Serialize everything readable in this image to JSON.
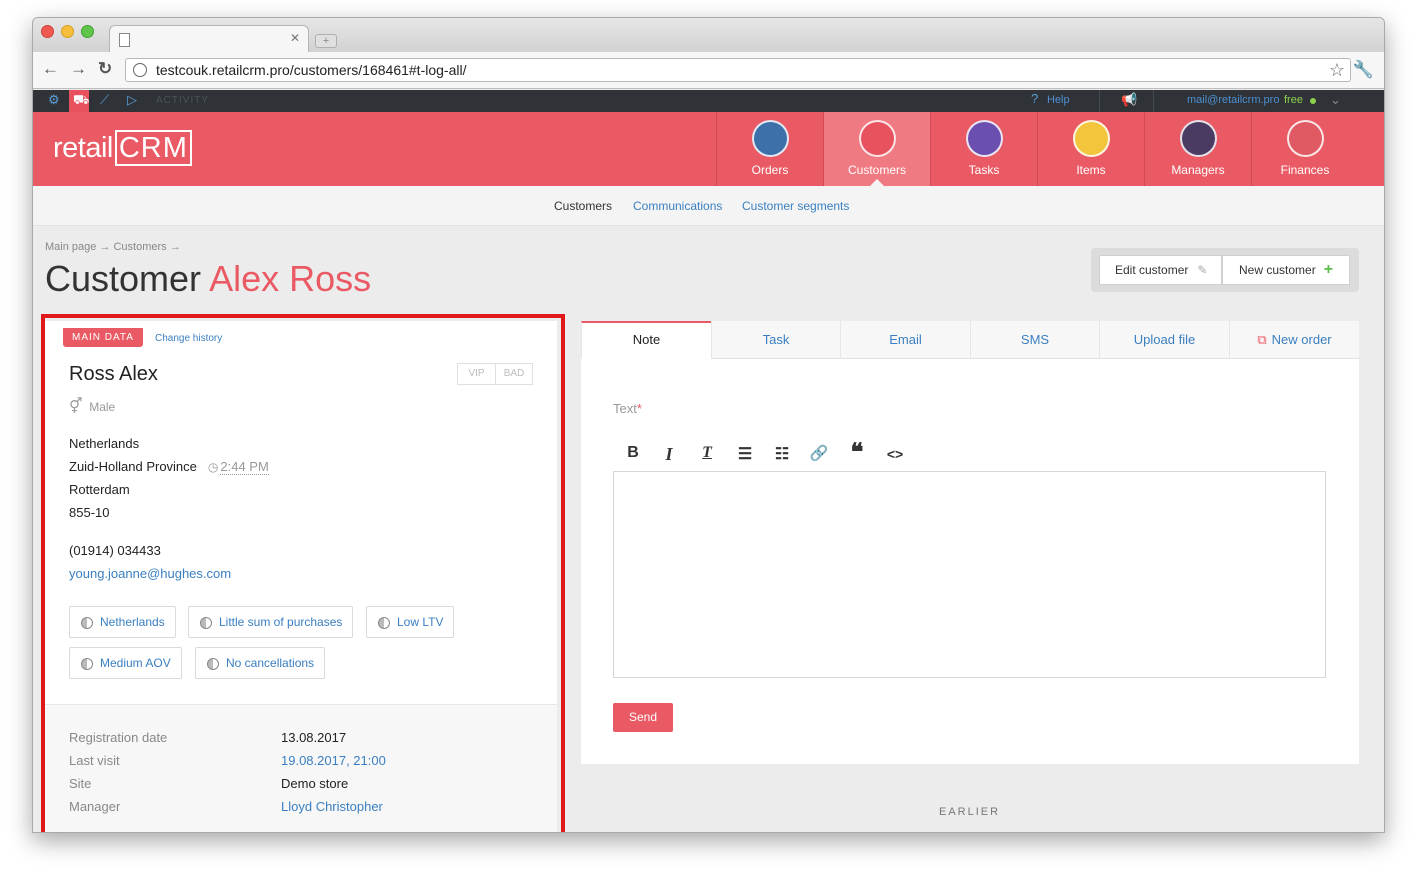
{
  "browser": {
    "url": "testcouk.retailcrm.pro/customers/168461#t-log-all/"
  },
  "sysbar": {
    "activity": "ACTIVITY",
    "help": "Help",
    "email": "mail@retailcrm.pro",
    "plan": "free"
  },
  "header": {
    "logo_text": "retail",
    "logo_box": "CRM",
    "menu": [
      {
        "label": "Orders",
        "icon": "cart-icon",
        "color": "#3d6fa8"
      },
      {
        "label": "Customers",
        "icon": "customer-avatar-icon",
        "color": "#e8515e"
      },
      {
        "label": "Tasks",
        "icon": "tasks-list-icon",
        "color": "#6b4fb0"
      },
      {
        "label": "Items",
        "icon": "box-icon",
        "color": "#f2c53d"
      },
      {
        "label": "Managers",
        "icon": "manager-avatar-icon",
        "color": "#4a3b63"
      },
      {
        "label": "Finances",
        "icon": "finance-doc-icon",
        "color": "#e05a63"
      }
    ]
  },
  "subnav": {
    "items": [
      "Customers",
      "Communications",
      "Customer segments"
    ]
  },
  "page": {
    "breadcrumb": "Main page → Customers →",
    "title_prefix": "Customer",
    "title_name": "Alex Ross",
    "edit_button": "Edit customer",
    "new_button": "New customer"
  },
  "customer": {
    "main_data_label": "MAIN DATA",
    "change_history": "Change history",
    "name": "Ross Alex",
    "badge_vip": "VIP",
    "badge_bad": "BAD",
    "gender": "Male",
    "country": "Netherlands",
    "province": "Zuid-Holland Province",
    "local_time": "2:44 PM",
    "city": "Rotterdam",
    "postcode": "855-10",
    "phone": "(01914) 034433",
    "email": "young.joanne@hughes.com",
    "segments": [
      "Netherlands",
      "Little sum of purchases",
      "Low LTV",
      "Medium AOV",
      "No cancellations"
    ],
    "details": [
      {
        "label": "Registration date",
        "value": "13.08.2017"
      },
      {
        "label": "Last visit",
        "value": "19.08.2017, 21:00"
      },
      {
        "label": "Site",
        "value": "Demo store"
      },
      {
        "label": "Manager",
        "value": "Lloyd Christopher"
      }
    ]
  },
  "composer": {
    "tabs": [
      "Note",
      "Task",
      "Email",
      "SMS",
      "Upload file",
      "New order"
    ],
    "text_label": "Text",
    "required_mark": "*",
    "toolbar": [
      "bold-icon",
      "italic-icon",
      "clear-format-icon",
      "bullet-list-icon",
      "numbered-list-icon",
      "link-icon",
      "quote-icon",
      "code-icon"
    ],
    "send_label": "Send"
  },
  "history": {
    "earlier_label": "EARLIER"
  },
  "colors": {
    "brand": "#ea5a64",
    "link": "#3a7fc1",
    "highlight_frame": "#e0181b"
  }
}
